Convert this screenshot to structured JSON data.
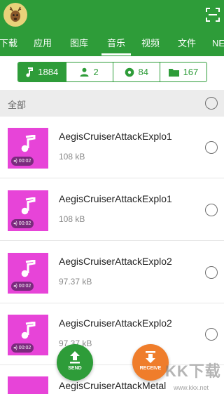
{
  "header": {
    "tabs": [
      {
        "label": "下载"
      },
      {
        "label": "应用"
      },
      {
        "label": "图库"
      },
      {
        "label": "音乐",
        "active": true
      },
      {
        "label": "视频"
      },
      {
        "label": "文件"
      },
      {
        "label": "NE"
      }
    ],
    "scan_icon": "scan-icon",
    "avatar_icon": "deer-avatar"
  },
  "filters": [
    {
      "icon": "music-note-icon",
      "count": "1884",
      "selected": true
    },
    {
      "icon": "person-icon",
      "count": "2"
    },
    {
      "icon": "disc-icon",
      "count": "84"
    },
    {
      "icon": "folder-icon",
      "count": "167"
    }
  ],
  "section": {
    "label": "全部"
  },
  "items": [
    {
      "title": "AegisCruiserAttackExplo1",
      "size": "108 kB",
      "duration": "00:02"
    },
    {
      "title": "AegisCruiserAttackExplo1",
      "size": "108 kB",
      "duration": "00:02"
    },
    {
      "title": "AegisCruiserAttackExplo2",
      "size": "97.37 kB",
      "duration": "00:02"
    },
    {
      "title": "AegisCruiserAttackExplo2",
      "size": "97.37 kB",
      "duration": "00:02"
    },
    {
      "title": "AegisCruiserAttackMetal",
      "size": "",
      "duration": ""
    }
  ],
  "fab": {
    "send_label": "SEND",
    "receive_label": "RECEIVE"
  },
  "watermark": {
    "text": "KK下载",
    "url": "www.kkx.net"
  },
  "colors": {
    "primary": "#2e9c39",
    "thumb": "#e744d8",
    "receive": "#ef7d2b",
    "section_bg": "#ececec"
  }
}
